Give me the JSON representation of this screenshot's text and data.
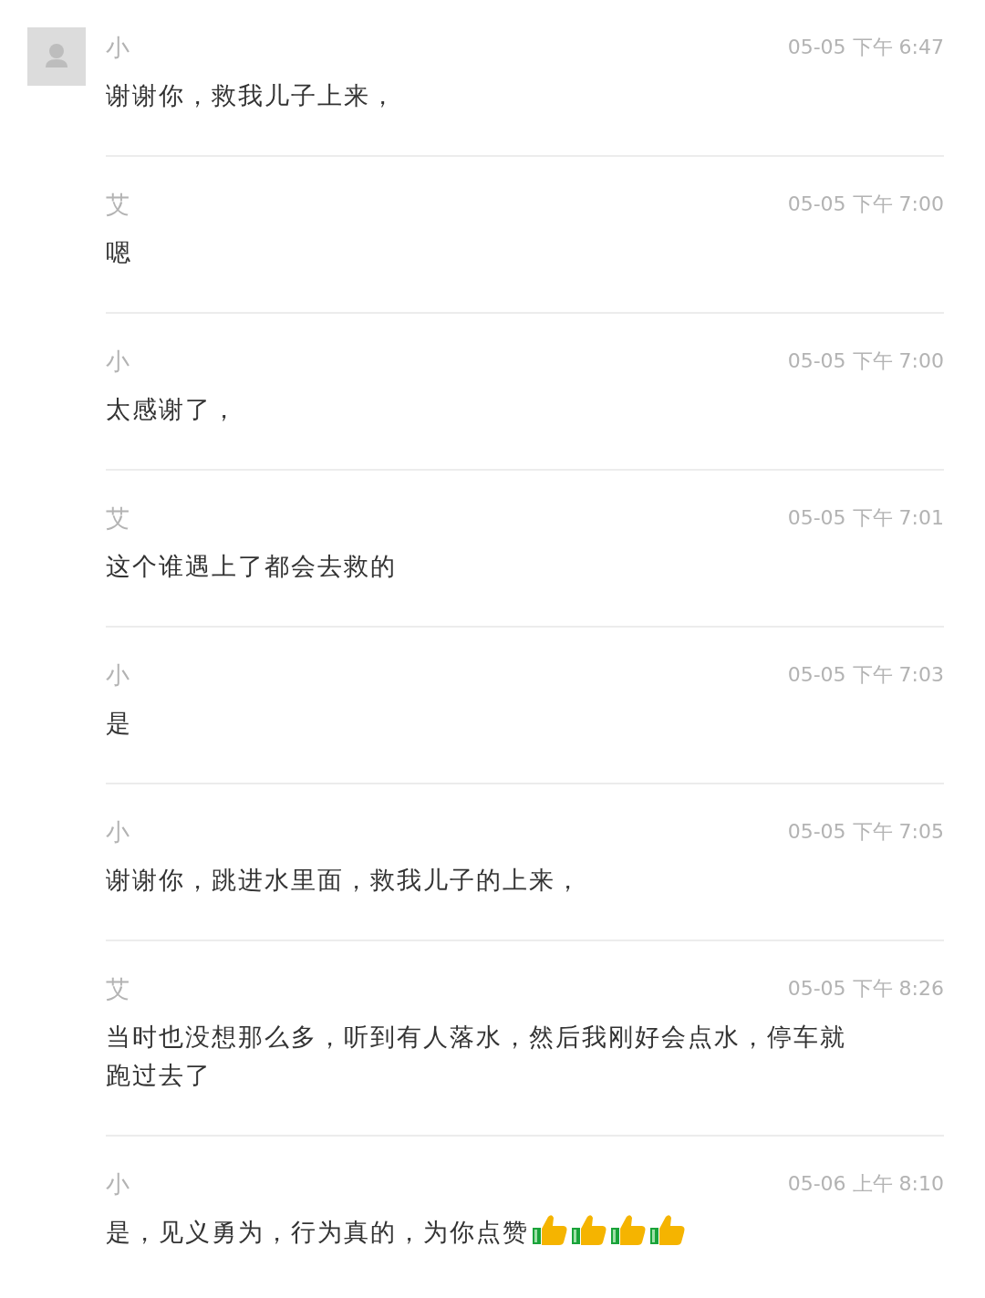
{
  "messages": [
    {
      "sender": "小",
      "time": "05-05 下午 6:47",
      "text": "谢谢你，救我儿子上来，",
      "show_avatar": true
    },
    {
      "sender": "艾",
      "time": "05-05 下午 7:00",
      "text": "嗯",
      "show_avatar": false
    },
    {
      "sender": "小",
      "time": "05-05 下午 7:00",
      "text": "太感谢了，",
      "show_avatar": false
    },
    {
      "sender": "艾",
      "time": "05-05 下午 7:01",
      "text": "这个谁遇上了都会去救的",
      "show_avatar": false
    },
    {
      "sender": "小",
      "time": "05-05 下午 7:03",
      "text": "是",
      "show_avatar": false
    },
    {
      "sender": "小",
      "time": "05-05 下午 7:05",
      "text": "谢谢你，跳进水里面，救我儿子的上来，",
      "show_avatar": false
    },
    {
      "sender": "艾",
      "time": "05-05 下午 8:26",
      "text": "当时也没想那么多，听到有人落水，然后我刚好会点水，停车就跑过去了",
      "show_avatar": false
    },
    {
      "sender": "小",
      "time": "05-06 上午 8:10",
      "text": "是，见义勇为，行为真的，为你点赞",
      "show_avatar": false,
      "reactions": [
        {
          "kind": "thumbs_up"
        },
        {
          "kind": "thumbs_up"
        },
        {
          "kind": "thumbs_up"
        },
        {
          "kind": "thumbs_up"
        }
      ]
    }
  ]
}
